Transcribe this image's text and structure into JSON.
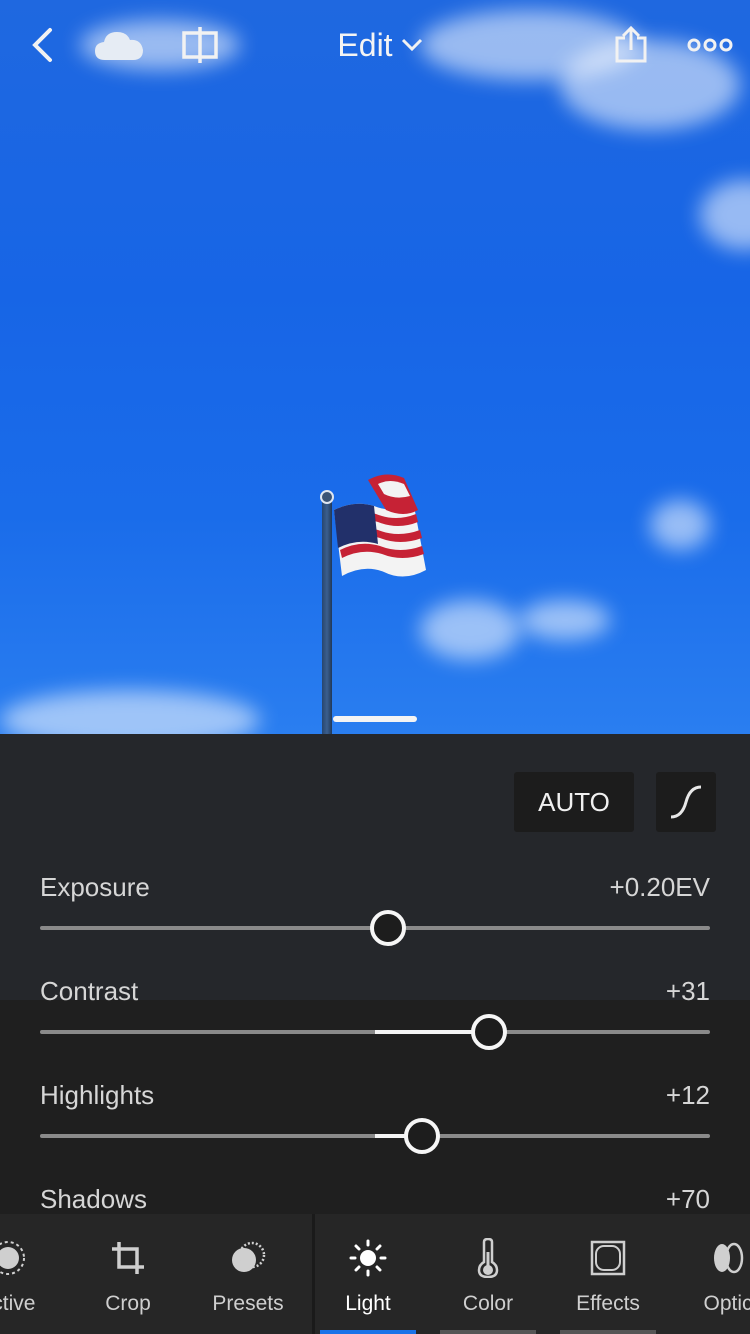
{
  "topbar": {
    "back_icon": "chevron-left-icon",
    "cloud_icon": "cloud-icon",
    "compare_icon": "compare-icon",
    "title": "Edit",
    "share_icon": "share-icon",
    "more_icon": "more-icon"
  },
  "panel": {
    "auto_label": "AUTO",
    "curve_icon": "tone-curve-icon",
    "sliders": [
      {
        "label": "Exposure",
        "value": "+0.20EV",
        "level": 0.52
      },
      {
        "label": "Contrast",
        "value": "+31",
        "level": 0.67
      },
      {
        "label": "Highlights",
        "value": "+12",
        "level": 0.57
      },
      {
        "label": "Shadows",
        "value": "+70"
      }
    ]
  },
  "toolbar": {
    "tools": [
      {
        "label": "ective",
        "icon": "selective-icon"
      },
      {
        "label": "Crop",
        "icon": "crop-icon"
      },
      {
        "label": "Presets",
        "icon": "presets-icon"
      },
      {
        "label": "Light",
        "icon": "sun-icon",
        "active": true
      },
      {
        "label": "Color",
        "icon": "thermometer-icon"
      },
      {
        "label": "Effects",
        "icon": "effects-icon"
      },
      {
        "label": "Optic",
        "icon": "optics-icon"
      }
    ]
  },
  "colors": {
    "accent": "#1a73e8",
    "sky": "#1765e6"
  }
}
